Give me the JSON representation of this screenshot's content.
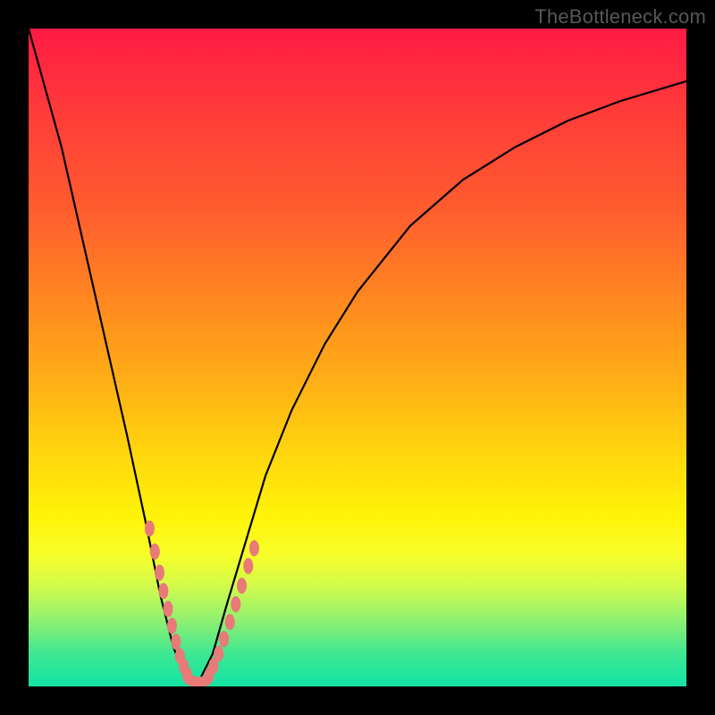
{
  "watermark": "TheBottleneck.com",
  "chart_data": {
    "type": "line",
    "title": "",
    "xlabel": "",
    "ylabel": "",
    "ylim": [
      0,
      100
    ],
    "x": [
      0.0,
      0.05,
      0.1,
      0.15,
      0.18,
      0.2,
      0.22,
      0.24,
      0.25,
      0.26,
      0.28,
      0.3,
      0.33,
      0.36,
      0.4,
      0.45,
      0.5,
      0.58,
      0.66,
      0.74,
      0.82,
      0.9,
      1.0
    ],
    "y": [
      100,
      82,
      60,
      38,
      24,
      14,
      6,
      1,
      0,
      1,
      5,
      12,
      22,
      32,
      42,
      52,
      60,
      70,
      77,
      82,
      86,
      89,
      92
    ],
    "annotations": {
      "note": "V-shaped bottleneck curve; minimum near x≈0.25. Pink bead markers clustered near the valley on both branches."
    },
    "beads_left": [
      [
        0.184,
        0.24
      ],
      [
        0.192,
        0.205
      ],
      [
        0.199,
        0.173
      ],
      [
        0.205,
        0.145
      ],
      [
        0.212,
        0.118
      ],
      [
        0.218,
        0.092
      ],
      [
        0.224,
        0.068
      ],
      [
        0.23,
        0.046
      ],
      [
        0.236,
        0.03
      ],
      [
        0.241,
        0.017
      ]
    ],
    "beads_bottom": [
      [
        0.248,
        0.009
      ],
      [
        0.254,
        0.006
      ],
      [
        0.26,
        0.006
      ],
      [
        0.266,
        0.008
      ]
    ],
    "beads_right": [
      [
        0.274,
        0.016
      ],
      [
        0.281,
        0.031
      ],
      [
        0.289,
        0.05
      ],
      [
        0.297,
        0.072
      ],
      [
        0.306,
        0.098
      ],
      [
        0.315,
        0.125
      ],
      [
        0.324,
        0.153
      ],
      [
        0.334,
        0.183
      ],
      [
        0.343,
        0.21
      ]
    ]
  },
  "colors": {
    "bead": "#e87a78",
    "curve": "#000000"
  }
}
